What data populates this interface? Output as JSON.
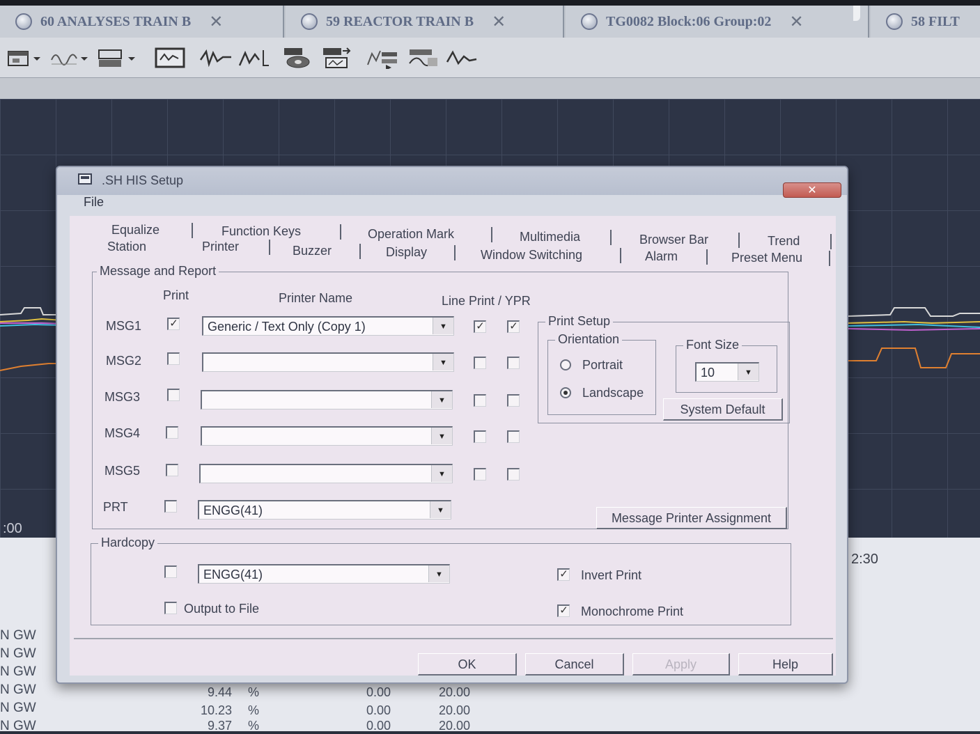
{
  "app_tabs": [
    {
      "label": "60 ANALYSES TRAIN B",
      "close": "✕"
    },
    {
      "label": "59 REACTOR TRAIN B",
      "close": "✕"
    },
    {
      "label": "TG0082 Block:06 Group:02",
      "close": "✕"
    },
    {
      "label": "58 FILT"
    }
  ],
  "trend": {
    "time_left": ":00",
    "time_right": "2:30"
  },
  "background_table": {
    "tags": [
      "N GW",
      "N GW",
      "N GW",
      "N GW",
      "N GW",
      "N GW"
    ],
    "rows": [
      {
        "value": "9.44",
        "unit": "%",
        "low": "0.00",
        "high": "20.00"
      },
      {
        "value": "10.23",
        "unit": "%",
        "low": "0.00",
        "high": "20.00"
      },
      {
        "value": "9.37",
        "unit": "%",
        "low": "0.00",
        "high": "20.00"
      }
    ]
  },
  "dialog": {
    "title": ".SH HIS Setup",
    "close": "✕",
    "menu": {
      "file": "File"
    },
    "tabs_row1": [
      "Equalize",
      "Function Keys",
      "Operation Mark",
      "Multimedia",
      "Browser Bar",
      "Trend"
    ],
    "tabs_row2": [
      "Station",
      "Printer",
      "Buzzer",
      "Display",
      "Window Switching",
      "Alarm",
      "Preset Menu"
    ],
    "active_tab": "Printer",
    "message_report": {
      "title": "Message and Report",
      "col_print": "Print",
      "col_printer_name": "Printer Name",
      "col_line_print": "Line Print / YPR",
      "rows": [
        {
          "label": "MSG1",
          "print": "✓",
          "printer": "Generic / Text Only (Copy 1)",
          "line_print": "✓",
          "ypr": "✓"
        },
        {
          "label": "MSG2",
          "print": "",
          "printer": "",
          "line_print": "",
          "ypr": ""
        },
        {
          "label": "MSG3",
          "print": "",
          "printer": "",
          "line_print": "",
          "ypr": ""
        },
        {
          "label": "MSG4",
          "print": "",
          "printer": "",
          "line_print": "",
          "ypr": ""
        },
        {
          "label": "MSG5",
          "print": "",
          "printer": "",
          "line_print": "",
          "ypr": ""
        },
        {
          "label": "PRT",
          "print": "",
          "printer": "ENGG(41)"
        }
      ],
      "print_setup": {
        "title": "Print Setup",
        "orientation_title": "Orientation",
        "portrait": "Portrait",
        "landscape": "Landscape",
        "selected": "Landscape",
        "font_size_title": "Font Size",
        "font_size": "10",
        "system_default": "System Default"
      },
      "assignment_button": "Message Printer Assignment"
    },
    "hardcopy": {
      "title": "Hardcopy",
      "print": "",
      "printer": "ENGG(41)",
      "output_to_file": "Output to File",
      "output_to_file_checked": "",
      "invert_print": "Invert Print",
      "invert_print_checked": "✓",
      "monochrome_print": "Monochrome Print",
      "monochrome_print_checked": "✓"
    },
    "buttons": {
      "ok": "OK",
      "cancel": "Cancel",
      "apply": "Apply",
      "help": "Help"
    }
  }
}
